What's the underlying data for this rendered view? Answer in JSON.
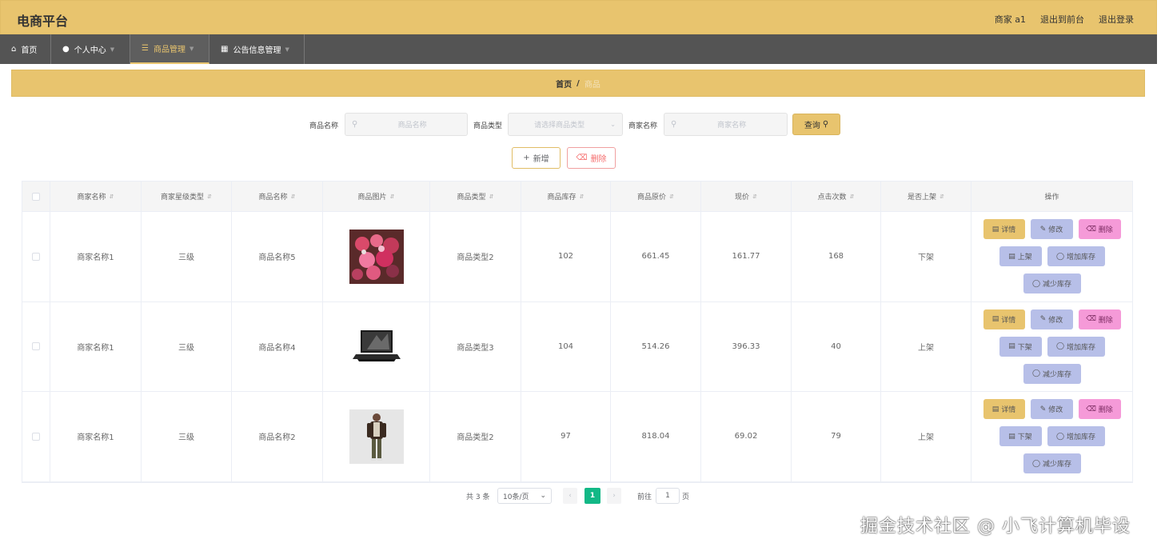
{
  "app": {
    "title": "电商平台"
  },
  "top_right": {
    "user": "商家 a1",
    "to_front": "退出到前台",
    "logout": "退出登录"
  },
  "nav": [
    {
      "icon": "home-icon",
      "label": "首页"
    },
    {
      "icon": "user-icon",
      "label": "个人中心"
    },
    {
      "icon": "menu-icon",
      "label": "商品管理"
    },
    {
      "icon": "notice-icon",
      "label": "公告信息管理"
    }
  ],
  "breadcrumb": {
    "home": "首页",
    "sep": "/",
    "current": "商品"
  },
  "search": {
    "product_name_label": "商品名称",
    "product_name_placeholder": "商品名称",
    "product_type_label": "商品类型",
    "product_type_placeholder": "请选择商品类型",
    "merchant_name_label": "商家名称",
    "merchant_name_placeholder": "商家名称",
    "query_label": "查询"
  },
  "actions": {
    "add_label": "新增",
    "delete_label": "删除"
  },
  "table": {
    "headers": [
      "商家名称",
      "商家星级类型",
      "商品名称",
      "商品图片",
      "商品类型",
      "商品库存",
      "商品原价",
      "现价",
      "点击次数",
      "是否上架",
      "操作"
    ],
    "rows": [
      {
        "merchant": "商家名称1",
        "star": "三级",
        "name": "商品名称5",
        "image": "flowers-bouquet",
        "type": "商品类型2",
        "stock": "102",
        "orig": "661.45",
        "price": "161.77",
        "clicks": "168",
        "on_shelf": "下架",
        "shelf_btn": "上架"
      },
      {
        "merchant": "商家名称1",
        "star": "三级",
        "name": "商品名称4",
        "image": "laptop",
        "type": "商品类型3",
        "stock": "104",
        "orig": "514.26",
        "price": "396.33",
        "clicks": "40",
        "on_shelf": "上架",
        "shelf_btn": "下架"
      },
      {
        "merchant": "商家名称1",
        "star": "三级",
        "name": "商品名称2",
        "image": "man-in-jacket",
        "type": "商品类型2",
        "stock": "97",
        "orig": "818.04",
        "price": "69.02",
        "clicks": "79",
        "on_shelf": "上架",
        "shelf_btn": "下架"
      }
    ],
    "op_labels": {
      "detail": "详情",
      "edit": "修改",
      "delete": "删除",
      "add_stock": "增加库存",
      "reduce_stock": "减少库存"
    }
  },
  "pagination": {
    "total": "共 3 条",
    "page_size": "10条/页",
    "current_page": "1",
    "goto_label": "前往",
    "goto_value": "1",
    "page_unit": "页"
  },
  "watermark": "掘金技术社区 @ 小飞计算机毕设",
  "colors": {
    "primary": "#e8c46e",
    "nav_bg": "#545454",
    "edit": "#b7bfe8",
    "delete": "#f59ad8",
    "page_active": "#12b886"
  }
}
